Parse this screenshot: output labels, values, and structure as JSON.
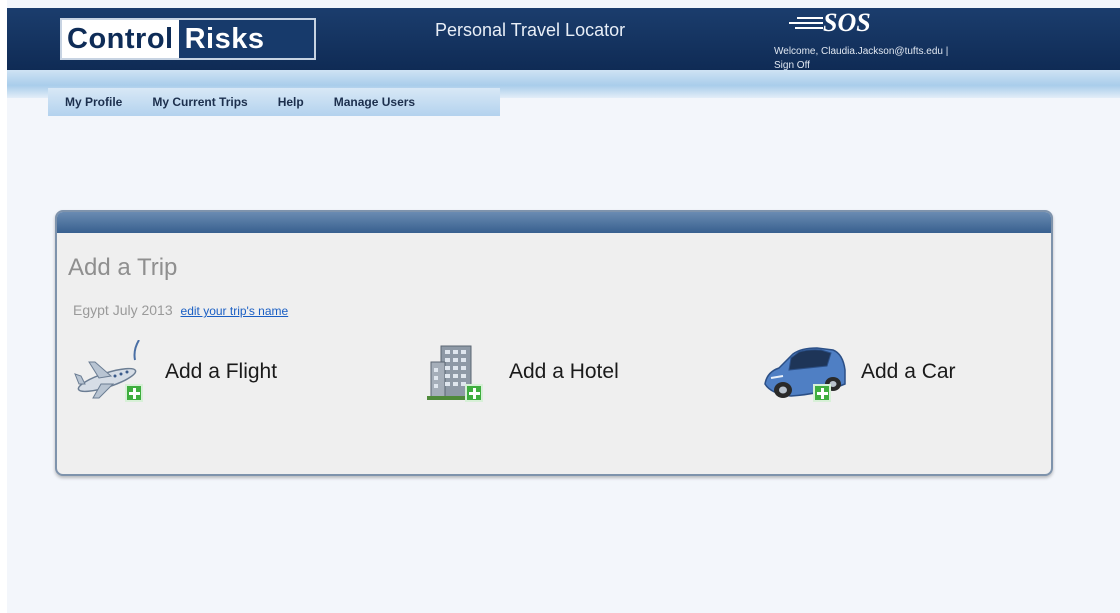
{
  "header": {
    "brand_part1": "Control",
    "brand_part2": "Risks",
    "app_title": "Personal Travel Locator",
    "partner_logo": "SOS",
    "welcome_text": "Welcome, Claudia.Jackson@tufts.edu |",
    "signoff_label": "Sign Off"
  },
  "nav": {
    "items": [
      {
        "label": "My Profile"
      },
      {
        "label": "My Current Trips"
      },
      {
        "label": "Help"
      },
      {
        "label": "Manage Users"
      }
    ]
  },
  "card": {
    "title": "Add a Trip",
    "trip_name": "Egypt July 2013",
    "edit_link": "edit your trip's name",
    "actions": [
      {
        "label": "Add a Flight",
        "icon": "airplane-icon"
      },
      {
        "label": "Add a Hotel",
        "icon": "hotel-icon"
      },
      {
        "label": "Add a Car",
        "icon": "car-icon"
      }
    ]
  },
  "colors": {
    "header_bg": "#0f2b55",
    "nav_bg": "#b3d2ee",
    "card_bar": "#38608f",
    "link": "#1a5fc4",
    "plus_badge": "#3fae3f"
  }
}
